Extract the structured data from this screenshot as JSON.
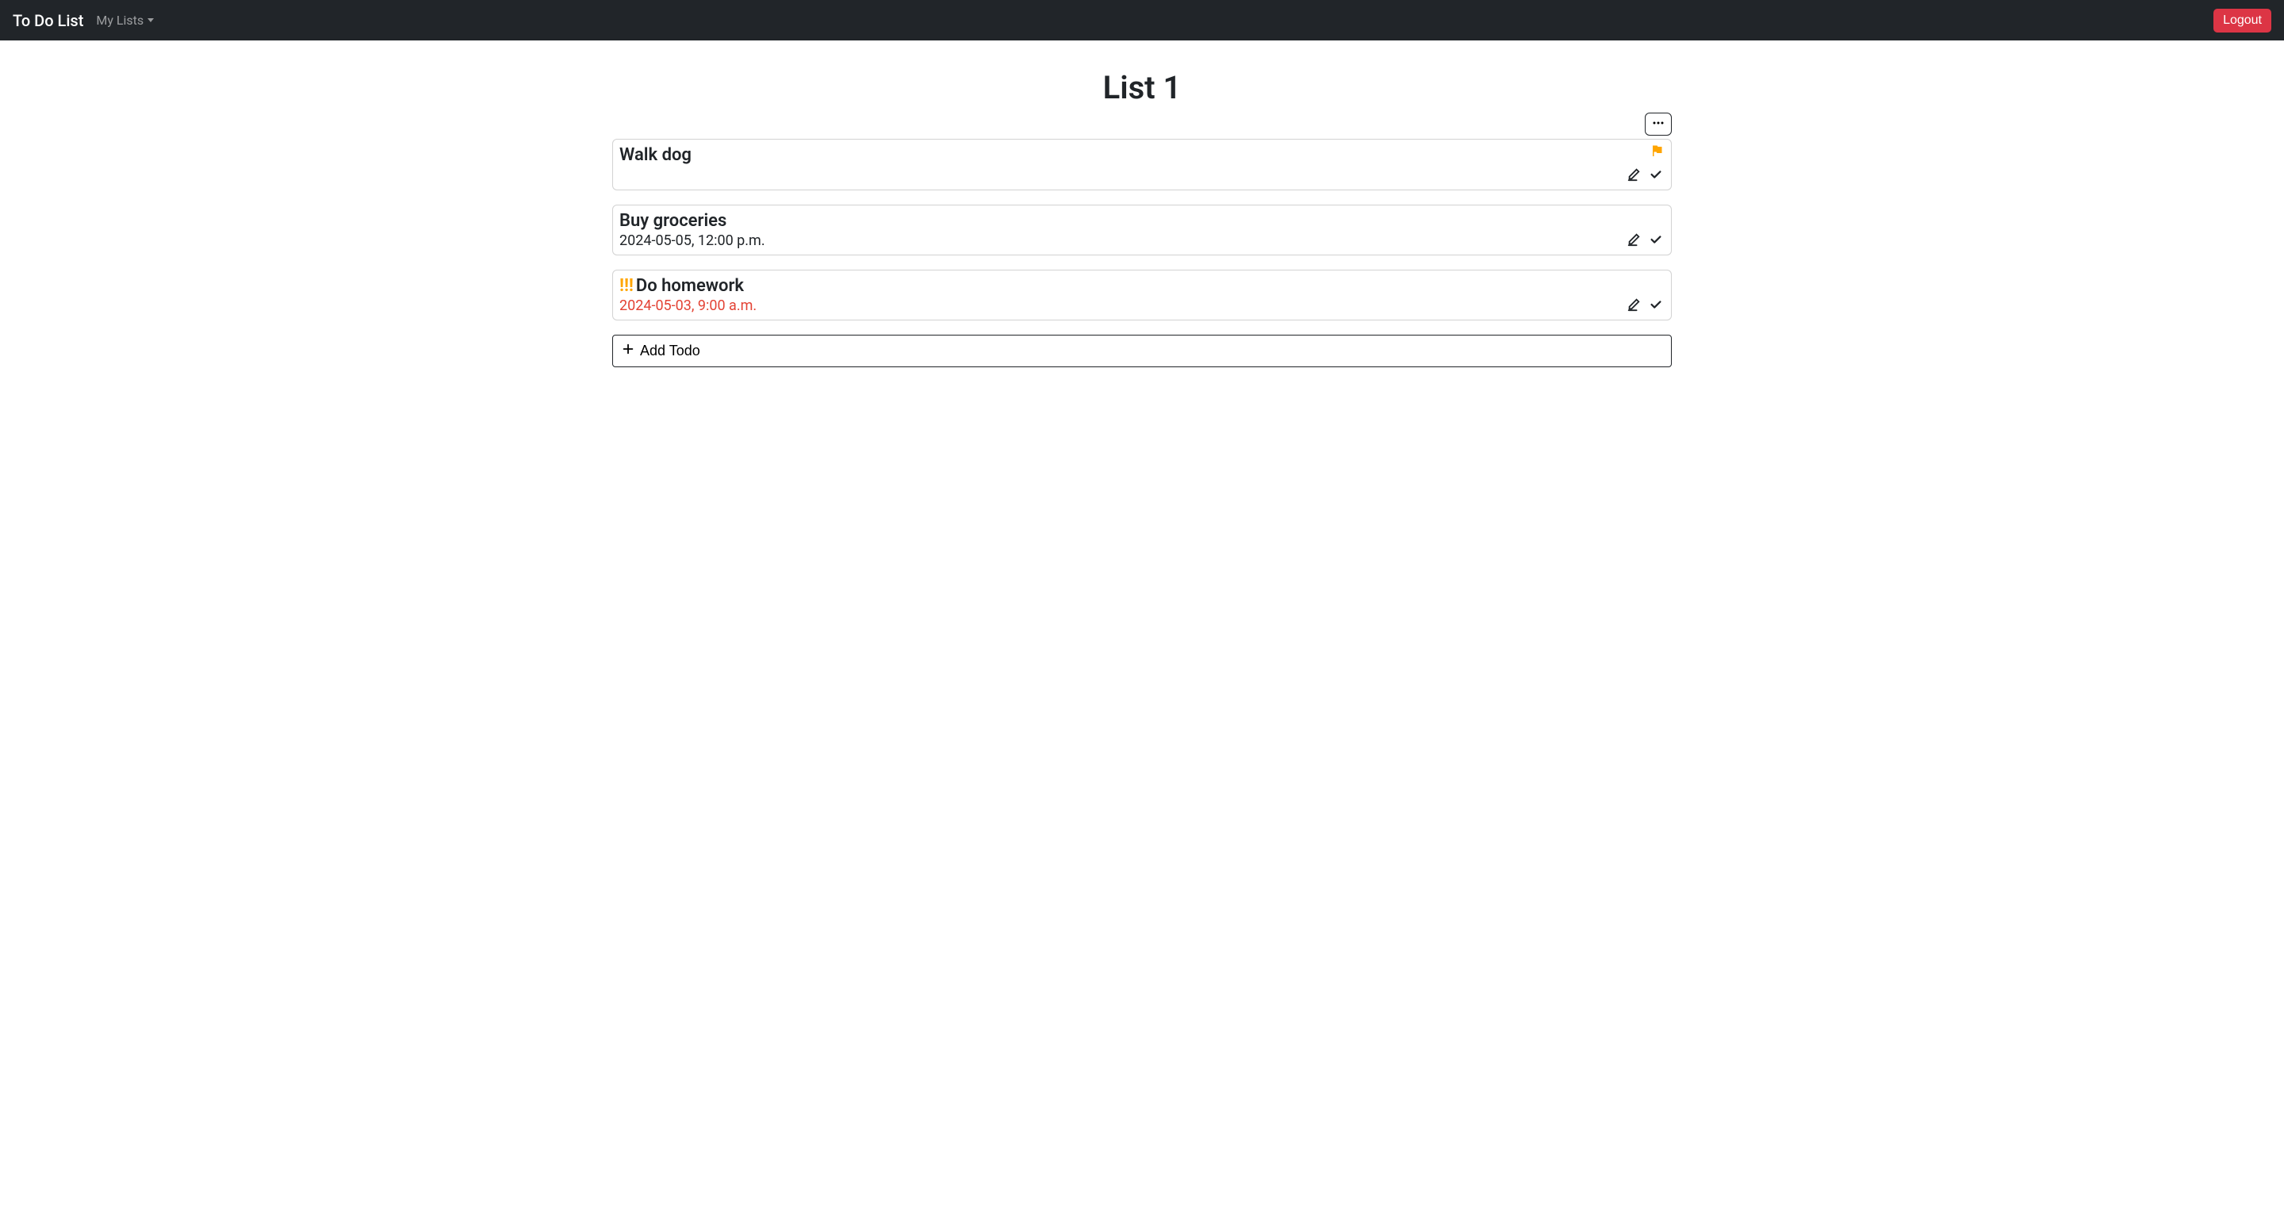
{
  "navbar": {
    "brand": "To Do List",
    "my_lists_label": "My Lists",
    "logout_label": "Logout"
  },
  "list": {
    "title": "List 1"
  },
  "todos": [
    {
      "title": "Walk dog",
      "date": "",
      "priority": "",
      "flagged": true,
      "late": false
    },
    {
      "title": "Buy groceries",
      "date": "2024-05-05, 12:00 p.m.",
      "priority": "",
      "flagged": false,
      "late": false
    },
    {
      "title": "Do homework",
      "date": "2024-05-03, 9:00 a.m.",
      "priority": "!!!",
      "flagged": false,
      "late": true
    }
  ],
  "add_todo_label": "Add Todo"
}
